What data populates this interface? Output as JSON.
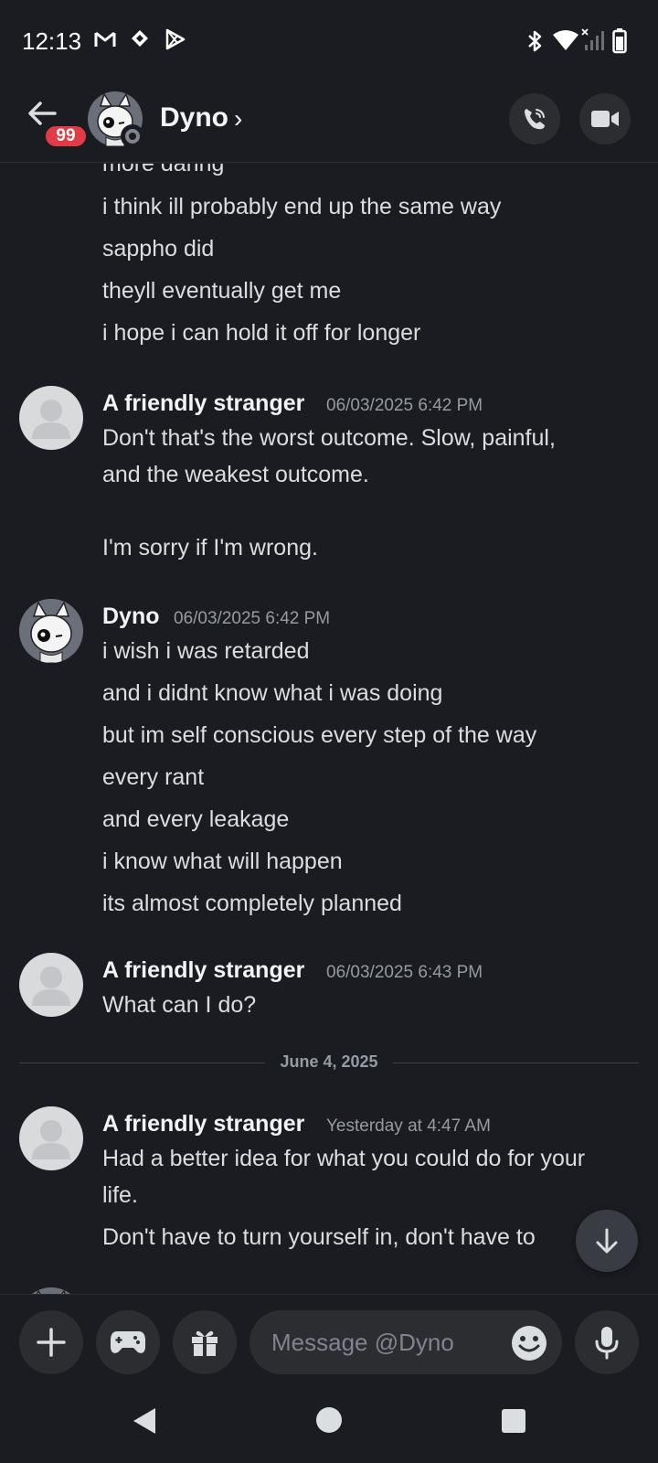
{
  "status_bar": {
    "time": "12:13",
    "left_icons": [
      "gmail-icon",
      "shop-icon",
      "play-store-icon"
    ],
    "right_icons": [
      "bluetooth-icon",
      "wifi-icon",
      "signal-icon",
      "battery-icon"
    ]
  },
  "header": {
    "back_badge": "99",
    "name": "Dyno",
    "chevron": "›"
  },
  "messages": {
    "continuation": [
      "more daring",
      "i think ill probably end up the same way",
      "sappho did",
      "theyll eventually get me",
      "i hope i can hold it off for longer"
    ],
    "group1": {
      "author": "A friendly stranger",
      "timestamp": "06/03/2025 6:42 PM",
      "lines": [
        "Don't that's the worst outcome. Slow, painful,",
        "and the weakest outcome.",
        "I'm sorry if I'm wrong."
      ]
    },
    "group2": {
      "author": "Dyno",
      "timestamp": "06/03/2025 6:42 PM",
      "lines": [
        "i wish i was retarded",
        "and i didnt know what i was doing",
        "but im self conscious every step of the way",
        "every rant",
        "and every leakage",
        "i know what will happen",
        "its almost completely planned"
      ]
    },
    "group3": {
      "author": "A friendly stranger",
      "timestamp": "06/03/2025 6:43 PM",
      "lines": [
        "What can I do?"
      ]
    },
    "date_divider": "June 4, 2025",
    "group4": {
      "author": "A friendly stranger",
      "timestamp": "Yesterday at 4:47 AM",
      "lines": [
        "Had a better idea for what you could do for your",
        "life.",
        "Don't have to turn yourself in, don't have to"
      ]
    }
  },
  "composer": {
    "placeholder": "Message @Dyno"
  },
  "colors": {
    "background": "#1b1c21",
    "badge": "#e33b45",
    "button_bg": "#2b2d31",
    "text": "#dbdee1",
    "muted": "#949ba4"
  }
}
